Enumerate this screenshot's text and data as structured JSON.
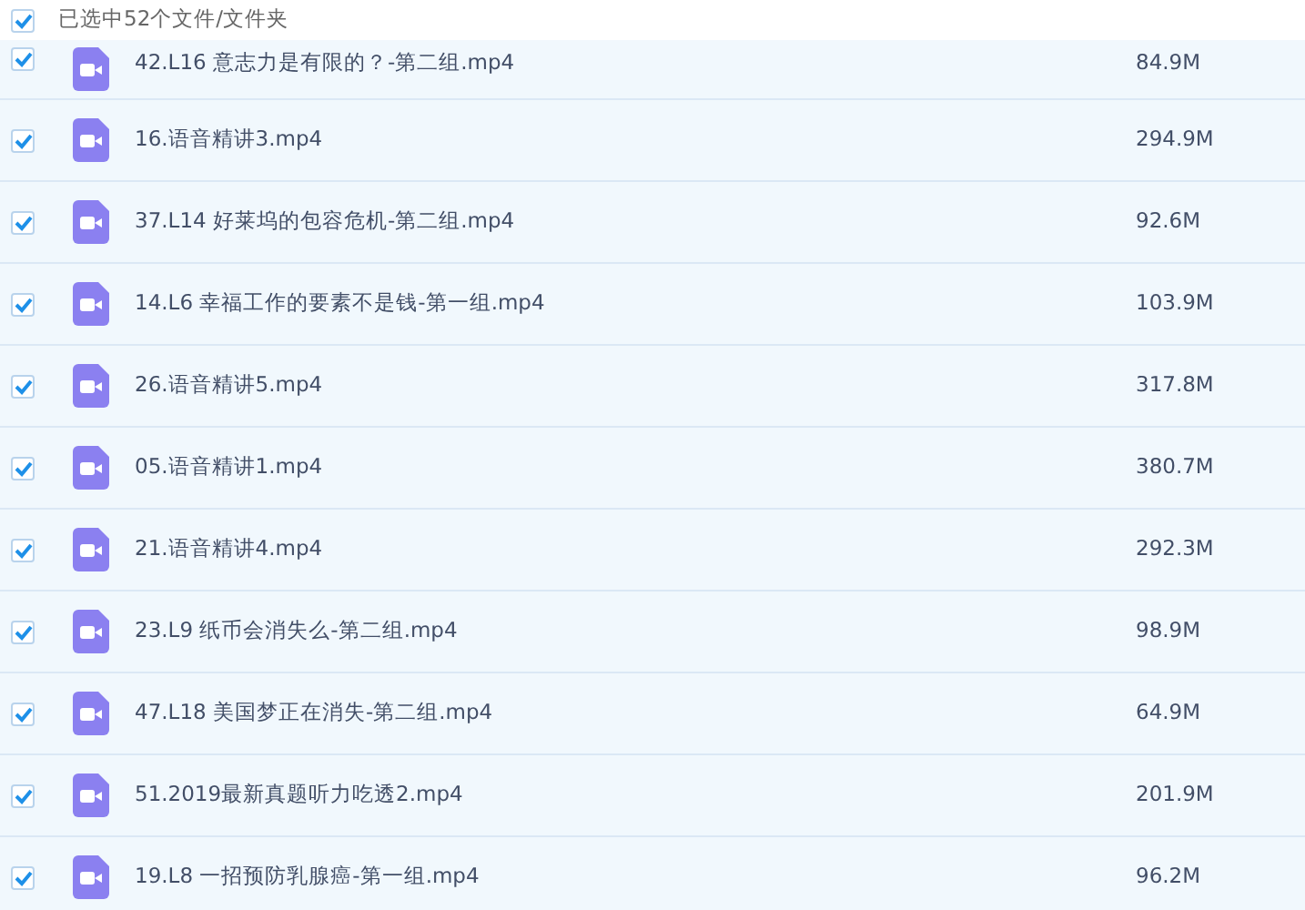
{
  "header": {
    "checked": true,
    "label": "已选中52个文件/文件夹"
  },
  "files": [
    {
      "name": "42.L16 意志力是有限的？-第二组.mp4",
      "size": "84.9M",
      "checked": true
    },
    {
      "name": "16.语音精讲3.mp4",
      "size": "294.9M",
      "checked": true
    },
    {
      "name": "37.L14 好莱坞的包容危机-第二组.mp4",
      "size": "92.6M",
      "checked": true
    },
    {
      "name": "14.L6 幸福工作的要素不是钱-第一组.mp4",
      "size": "103.9M",
      "checked": true
    },
    {
      "name": "26.语音精讲5.mp4",
      "size": "317.8M",
      "checked": true
    },
    {
      "name": "05.语音精讲1.mp4",
      "size": "380.7M",
      "checked": true
    },
    {
      "name": "21.语音精讲4.mp4",
      "size": "292.3M",
      "checked": true
    },
    {
      "name": "23.L9 纸币会消失么-第二组.mp4",
      "size": "98.9M",
      "checked": true
    },
    {
      "name": "47.L18 美国梦正在消失-第二组.mp4",
      "size": "64.9M",
      "checked": true
    },
    {
      "name": "51.2019最新真题听力吃透2.mp4",
      "size": "201.9M",
      "checked": true
    },
    {
      "name": "19.L8 一招预防乳腺癌-第一组.mp4",
      "size": "96.2M",
      "checked": true
    }
  ]
}
